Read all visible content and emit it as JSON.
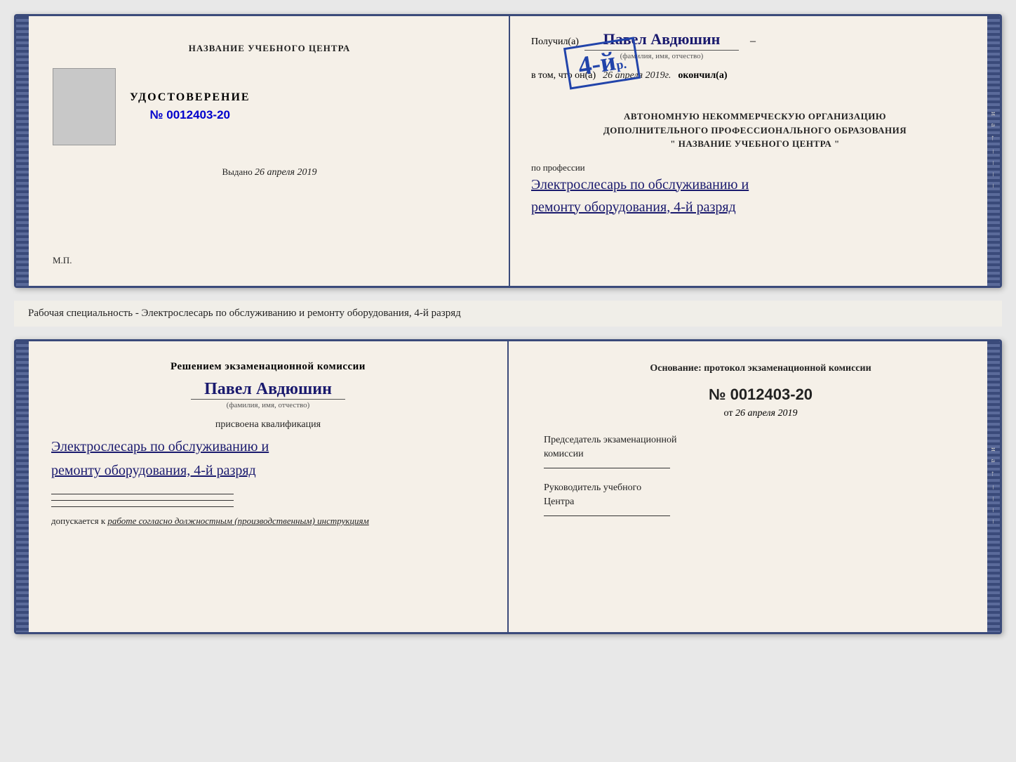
{
  "top_left": {
    "institution_name": "НАЗВАНИЕ УЧЕБНОГО ЦЕНТРА",
    "cert_title": "УДОСТОВЕРЕНИЕ",
    "cert_number": "№ 0012403-20",
    "issued_label": "Выдано",
    "issued_date": "26 апреля 2019",
    "mp": "М.П."
  },
  "top_right": {
    "received_label": "Получил(а)",
    "recipient_name": "Павел Авдюшин",
    "fio_label": "(фамилия, имя, отчество)",
    "in_that_label": "в том, что он(а)",
    "completion_date": "26 апреля 2019г.",
    "finished_label": "окончил(а)",
    "grade_label": "4-й",
    "grade_suffix": "р.",
    "org_line1": "АВТОНОМНУЮ НЕКОММЕРЧЕСКУЮ ОРГАНИЗАЦИЮ",
    "org_line2": "ДОПОЛНИТЕЛЬНОГО ПРОФЕССИОНАЛЬНОГО ОБРАЗОВАНИЯ",
    "org_line3": "\" НАЗВАНИЕ УЧЕБНОГО ЦЕНТРА \"",
    "profession_label": "по профессии",
    "profession_value": "Электрослесарь по обслуживанию и",
    "profession_value2": "ремонту оборудования, 4-й разряд"
  },
  "middle": {
    "specialty_text": "Рабочая специальность - Электрослесарь по обслуживанию и ремонту оборудования, 4-й разряд"
  },
  "bottom_left": {
    "decision_title": "Решением экзаменационной комиссии",
    "person_name": "Павел Авдюшин",
    "fio_label": "(фамилия, имя, отчество)",
    "assigned_text": "присвоена квалификация",
    "qualification_line1": "Электрослесарь по обслуживанию и",
    "qualification_line2": "ремонту оборудования, 4-й разряд",
    "allowed_label": "допускается к",
    "allowed_text": "работе согласно должностным (производственным) инструкциям"
  },
  "bottom_right": {
    "basis_label": "Основание: протокол экзаменационной комиссии",
    "protocol_number": "№ 0012403-20",
    "date_from_label": "от",
    "date_from_value": "26 апреля 2019",
    "chairman_line1": "Председатель экзаменационной",
    "chairman_line2": "комиссии",
    "director_line1": "Руководитель учебного",
    "director_line2": "Центра"
  },
  "side_chars": [
    "и",
    "а",
    "←",
    "–",
    "–",
    "–",
    "–",
    "–"
  ]
}
